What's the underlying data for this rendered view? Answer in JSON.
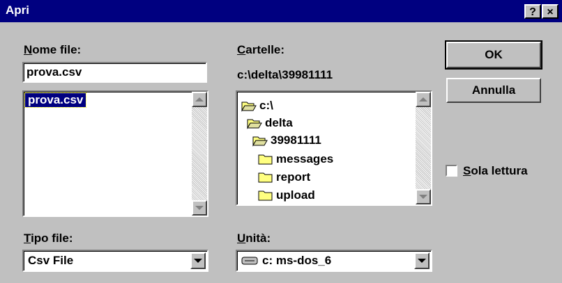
{
  "window": {
    "title": "Apri",
    "help_glyph": "?",
    "close_glyph": "×",
    "colors": {
      "titlebar": "#000080",
      "face": "#c0c0c0",
      "selection": "#000080"
    }
  },
  "file_name": {
    "label_accel": "N",
    "label_rest": "ome file:",
    "value": "prova.csv",
    "list_items": [
      "prova.csv"
    ]
  },
  "folders": {
    "label_accel": "C",
    "label_rest": "artelle:",
    "current_path": "c:\\delta\\39981111",
    "tree": [
      {
        "name": "c:\\",
        "icon": "open-folder-icon"
      },
      {
        "name": "delta",
        "icon": "open-folder-icon"
      },
      {
        "name": "39981111",
        "icon": "open-folder-icon"
      },
      {
        "name": "messages",
        "icon": "folder-icon"
      },
      {
        "name": "report",
        "icon": "folder-icon"
      },
      {
        "name": "upload",
        "icon": "folder-icon"
      }
    ]
  },
  "file_type": {
    "label_accel": "T",
    "label_rest": "ipo file:",
    "selected": "Csv File"
  },
  "drive": {
    "label_accel": "U",
    "label_rest": "nità:",
    "selected": "c: ms-dos_6",
    "icon": "drive-icon"
  },
  "buttons": {
    "ok": "OK",
    "cancel": "Annulla"
  },
  "read_only": {
    "label_accel": "S",
    "label_rest": "ola lettura",
    "checked": false
  }
}
